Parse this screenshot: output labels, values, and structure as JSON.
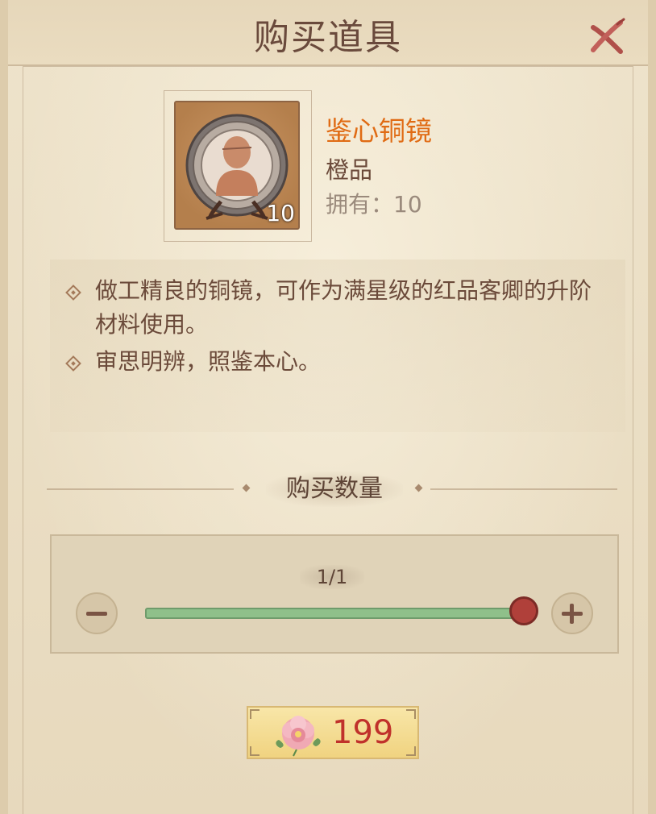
{
  "dialog": {
    "title": "购买道具"
  },
  "item": {
    "name": "鉴心铜镜",
    "grade": "橙品",
    "owned_text": "拥有：10",
    "count": "10",
    "name_color": "#e06b14",
    "icon": "bronze-mirror-icon"
  },
  "description": [
    "做工精良的铜镜，可作为满星级的红品客卿的升阶材料使用。",
    "审思明辨，照鉴本心。"
  ],
  "quantity": {
    "section_label": "购买数量",
    "text": "1/1",
    "fraction": 1.0
  },
  "buy": {
    "price": "199",
    "currency_icon": "peony-flower-icon",
    "price_color": "#c0312b"
  },
  "colors": {
    "slider_fill": "#8fc08a",
    "slider_knob": "#b0403a"
  }
}
